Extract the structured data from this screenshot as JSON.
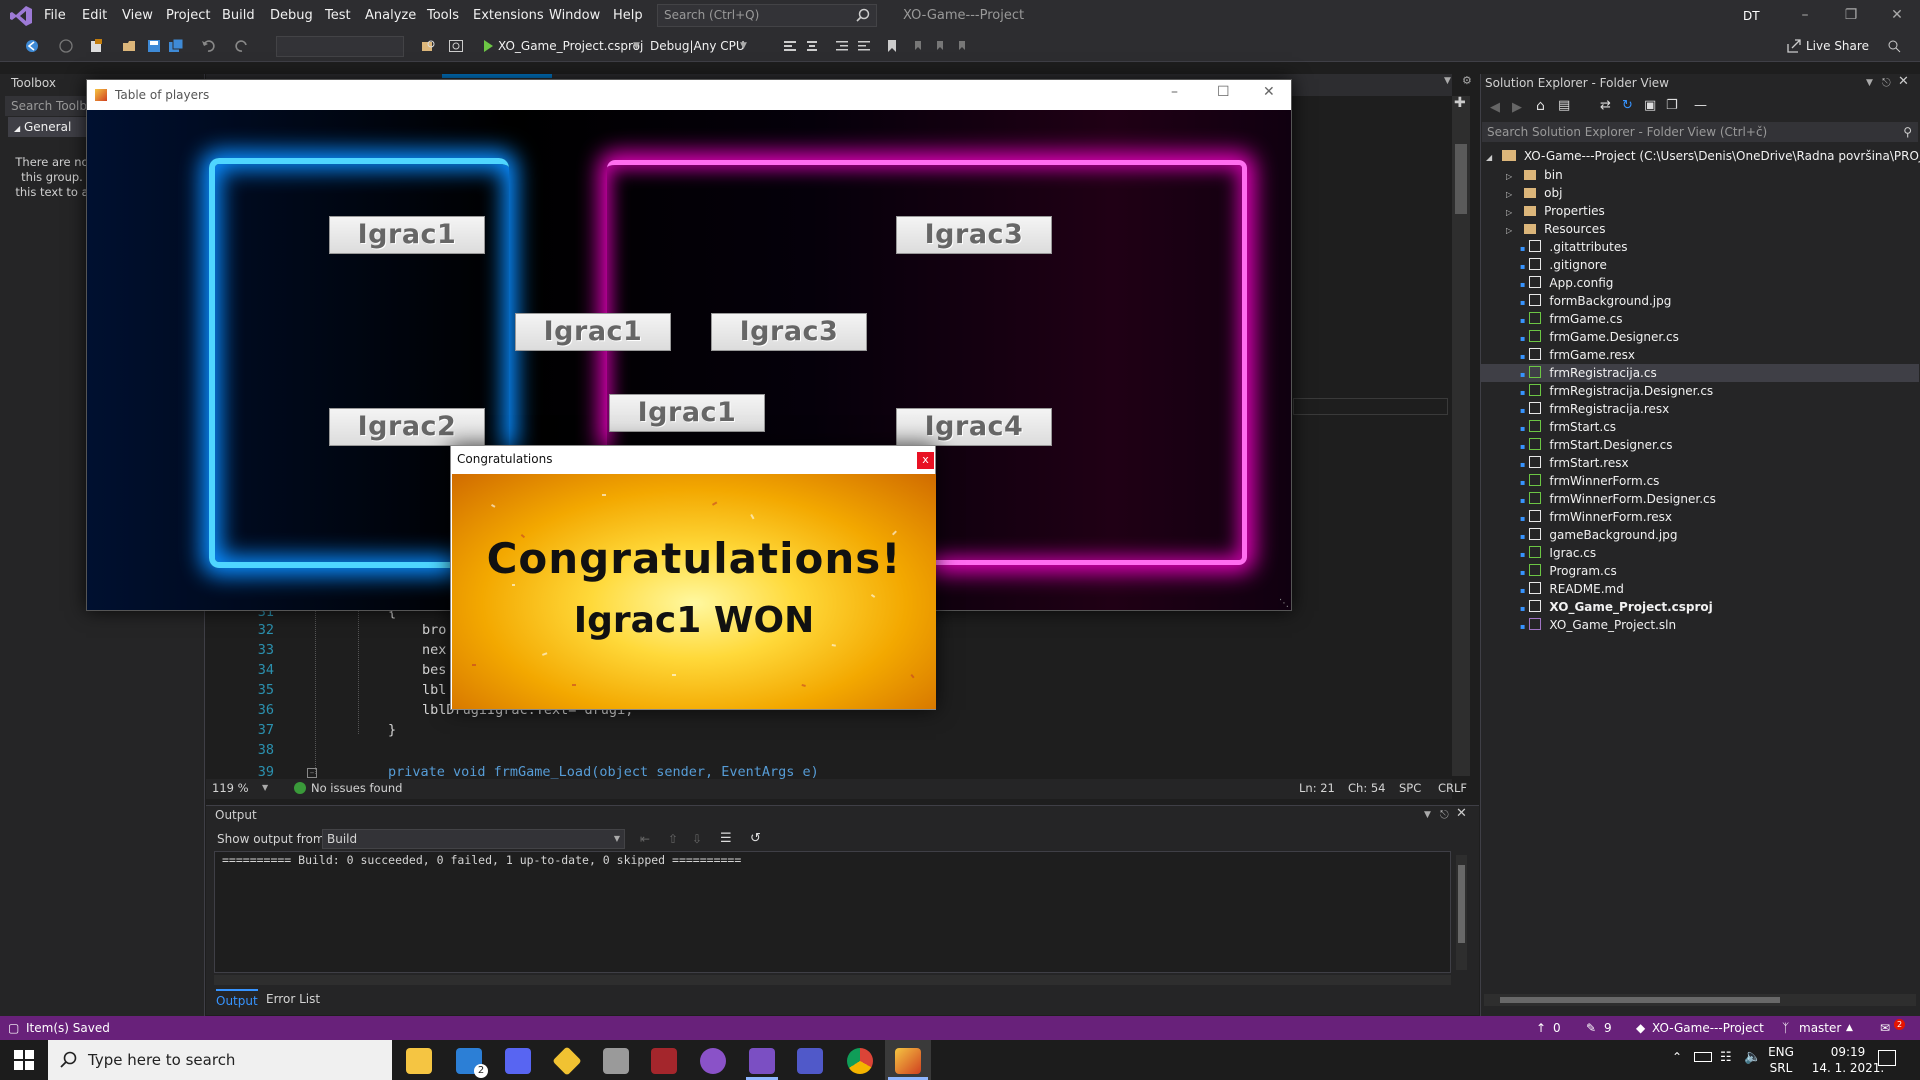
{
  "menubar": {
    "items": [
      "File",
      "Edit",
      "View",
      "Project",
      "Build",
      "Debug",
      "Test",
      "Analyze",
      "Tools",
      "Extensions",
      "Window",
      "Help"
    ],
    "search_placeholder": "Search (Ctrl+Q)",
    "window_title": "XO-Game---Project",
    "user_initials": "DT"
  },
  "toolbar": {
    "start_project": "XO_Game_Project.csproj",
    "configuration": "Debug|Any CPU",
    "live_share": "Live Share"
  },
  "toolbox": {
    "title": "Toolbox",
    "search_placeholder": "Search Toolbo",
    "group": "General",
    "empty_text": [
      "There are no",
      "this group.",
      "this text to a"
    ]
  },
  "game_window": {
    "title": "Table of players",
    "players": [
      "Igrac1",
      "Igrac3",
      "Igrac1",
      "Igrac3",
      "Igrac2",
      "Igrac1",
      "Igrac4"
    ]
  },
  "congrats_dialog": {
    "title": "Congratulations",
    "close_label": "x",
    "heading": "Congratulations!",
    "winner_text": "Igrac1 WON"
  },
  "editor": {
    "lines": [
      {
        "num": "31",
        "text": "{"
      },
      {
        "num": "32",
        "text": "bro"
      },
      {
        "num": "33",
        "text": "nex"
      },
      {
        "num": "34",
        "text": "bes"
      },
      {
        "num": "35",
        "text": "lbl"
      },
      {
        "num": "36",
        "text": "lblDrugiIgrac.Text= drugi;"
      },
      {
        "num": "37",
        "text": "}"
      },
      {
        "num": "38",
        "text": ""
      },
      {
        "num": "39",
        "text": "private void frmGame_Load(object sender, EventArgs e)"
      }
    ],
    "zoom": "119 %",
    "issues": "No issues found",
    "ln": "Ln: 21",
    "ch": "Ch: 54",
    "spc": "SPC",
    "crlf": "CRLF"
  },
  "output": {
    "title": "Output",
    "show_output_from_label": "Show output from:",
    "source": "Build",
    "text": "========== Build: 0 succeeded, 0 failed, 1 up-to-date, 0 skipped ==========",
    "tabs": [
      "Output",
      "Error List"
    ]
  },
  "solution_explorer": {
    "title": "Solution Explorer - Folder View",
    "search_placeholder": "Search Solution Explorer - Folder View (Ctrl+č)",
    "root": "XO-Game---Project (C:\\Users\\Denis\\OneDrive\\Radna površina\\PROJECT:",
    "items": [
      {
        "label": "bin",
        "kind": "folder",
        "expand": true
      },
      {
        "label": "obj",
        "kind": "folder",
        "expand": true
      },
      {
        "label": "Properties",
        "kind": "folder",
        "expand": true
      },
      {
        "label": "Resources",
        "kind": "folder",
        "expand": true
      },
      {
        "label": ".gitattributes",
        "kind": "file"
      },
      {
        "label": ".gitignore",
        "kind": "file"
      },
      {
        "label": "App.config",
        "kind": "config"
      },
      {
        "label": "formBackground.jpg",
        "kind": "image"
      },
      {
        "label": "frmGame.cs",
        "kind": "cs"
      },
      {
        "label": "frmGame.Designer.cs",
        "kind": "cs"
      },
      {
        "label": "frmGame.resx",
        "kind": "resx"
      },
      {
        "label": "frmRegistracija.cs",
        "kind": "cs",
        "selected": true
      },
      {
        "label": "frmRegistracija.Designer.cs",
        "kind": "cs"
      },
      {
        "label": "frmRegistracija.resx",
        "kind": "resx"
      },
      {
        "label": "frmStart.cs",
        "kind": "cs"
      },
      {
        "label": "frmStart.Designer.cs",
        "kind": "cs"
      },
      {
        "label": "frmStart.resx",
        "kind": "resx"
      },
      {
        "label": "frmWinnerForm.cs",
        "kind": "cs"
      },
      {
        "label": "frmWinnerForm.Designer.cs",
        "kind": "cs"
      },
      {
        "label": "frmWinnerForm.resx",
        "kind": "resx"
      },
      {
        "label": "gameBackground.jpg",
        "kind": "image"
      },
      {
        "label": "Igrac.cs",
        "kind": "cs"
      },
      {
        "label": "Program.cs",
        "kind": "cs"
      },
      {
        "label": "README.md",
        "kind": "md"
      },
      {
        "label": "XO_Game_Project.csproj",
        "kind": "csproj",
        "bold": true
      },
      {
        "label": "XO_Game_Project.sln",
        "kind": "sln"
      }
    ]
  },
  "statusbar": {
    "message": "Item(s) Saved",
    "up_count": "0",
    "edit_count": "9",
    "repo": "XO-Game---Project",
    "branch": "master",
    "notifications": "2"
  },
  "taskbar": {
    "search_placeholder": "Type here to search",
    "lang": "ENG",
    "layout": "SRL",
    "time": "09:19",
    "date": "14. 1. 2021.",
    "mail_badge": "2"
  },
  "colors": {
    "vs_purple": "#68217a",
    "neon_blue": "#4fd6ff",
    "neon_pink": "#ff6ef0"
  }
}
